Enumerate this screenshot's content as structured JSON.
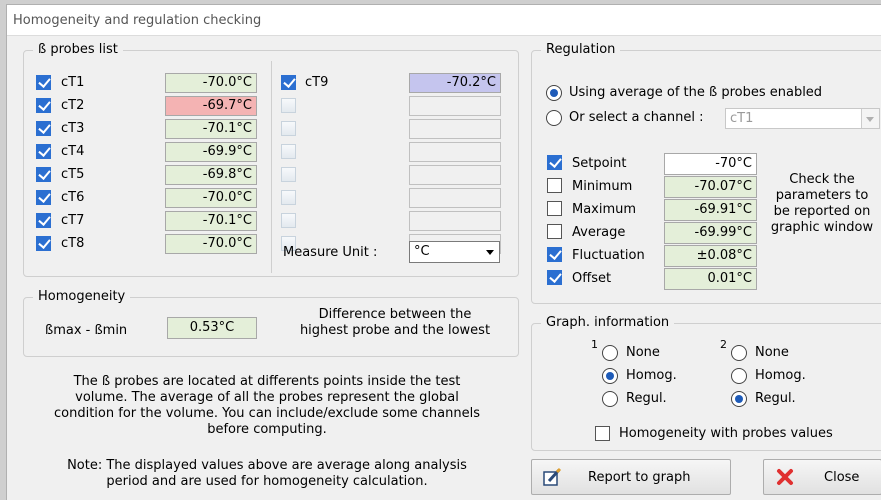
{
  "window": {
    "title": "Homogeneity and regulation checking"
  },
  "probes": {
    "legend": "ß probes list",
    "col1": [
      {
        "name": "cT1",
        "value": "-70.0°C",
        "checked": true,
        "color": "#e4efd9"
      },
      {
        "name": "cT2",
        "value": "-69.7°C",
        "checked": true,
        "color": "#f4b3b3"
      },
      {
        "name": "cT3",
        "value": "-70.1°C",
        "checked": true,
        "color": "#e4efd9"
      },
      {
        "name": "cT4",
        "value": "-69.9°C",
        "checked": true,
        "color": "#e4efd9"
      },
      {
        "name": "cT5",
        "value": "-69.8°C",
        "checked": true,
        "color": "#e4efd9"
      },
      {
        "name": "cT6",
        "value": "-70.0°C",
        "checked": true,
        "color": "#e4efd9"
      },
      {
        "name": "cT7",
        "value": "-70.1°C",
        "checked": true,
        "color": "#e4efd9"
      },
      {
        "name": "cT8",
        "value": "-70.0°C",
        "checked": true,
        "color": "#e4efd9"
      }
    ],
    "col2_first": {
      "name": "cT9",
      "value": "-70.2°C",
      "checked": true,
      "color": "#c5c5ee"
    },
    "measure_unit_label": "Measure Unit :",
    "measure_unit_value": "°C"
  },
  "homogeneity": {
    "legend": "Homogeneity",
    "label": "ßmax - ßmin",
    "value": "0.53°C",
    "value_color": "#e4efd9",
    "desc_line1": "Difference between the",
    "desc_line2": "highest probe and the lowest"
  },
  "info": {
    "p1": [
      "The ß probes are located at differents points inside the test",
      "volume. The average of all the probes represent the global",
      "condition for the volume. You can include/exclude some channels",
      "before computing."
    ],
    "p2": [
      "Note: The displayed values above are average along analysis",
      "period and are used for homogeneity calculation."
    ]
  },
  "regulation": {
    "legend": "Regulation",
    "opt_average": "Using average of the ß probes enabled",
    "opt_channel": "Or select a channel :",
    "channel_value": "cT1",
    "params": [
      {
        "label": "Setpoint",
        "value": "-70°C",
        "checked": true,
        "color": "#ffffff"
      },
      {
        "label": "Minimum",
        "value": "-70.07°C",
        "checked": false,
        "color": "#e4efd9"
      },
      {
        "label": "Maximum",
        "value": "-69.91°C",
        "checked": false,
        "color": "#e4efd9"
      },
      {
        "label": "Average",
        "value": "-69.99°C",
        "checked": false,
        "color": "#e4efd9"
      },
      {
        "label": "Fluctuation",
        "value": "±0.08°C",
        "checked": true,
        "color": "#e4efd9"
      },
      {
        "label": "Offset",
        "value": "0.01°C",
        "checked": true,
        "color": "#e4efd9"
      }
    ],
    "hint": [
      "Check the",
      "parameters to",
      "be reported on",
      "graphic window"
    ]
  },
  "graph": {
    "legend": "Graph. information",
    "g1_sup": "1",
    "g2_sup": "2",
    "none": "None",
    "homog": "Homog.",
    "regul": "Regul.",
    "with_probes": "Homogeneity with probes values"
  },
  "buttons": {
    "report": "Report to graph",
    "close": "Close"
  }
}
